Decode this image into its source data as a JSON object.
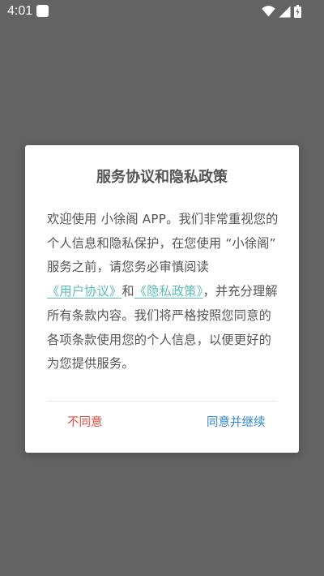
{
  "status_bar": {
    "time": "4:01",
    "icons": [
      "notification-icon",
      "wifi-icon",
      "signal-icon",
      "battery-icon"
    ]
  },
  "dialog": {
    "title": "服务协议和隐私政策",
    "body": {
      "part1": "欢迎使用 小徐阁 APP。我们非常重视您的个人信息和隐私保护，在您使用 “小徐阁” 服务之前，请您务必审慎阅读",
      "user_agreement_link": "《用户协议》",
      "conjunction": "和",
      "privacy_policy_link": "《隐私政策》",
      "part2": "，并充分理解所有条款内容。我们将严格按照您同意的各项条款使用您的个人信息，以便更好的为您提供服务。"
    },
    "buttons": {
      "disagree": "不同意",
      "agree": "同意并继续"
    }
  },
  "colors": {
    "overlay": "#636363",
    "link": "#5cbcb4",
    "disagree": "#e84a3e",
    "agree": "#2f87d8",
    "text": "#555555"
  }
}
